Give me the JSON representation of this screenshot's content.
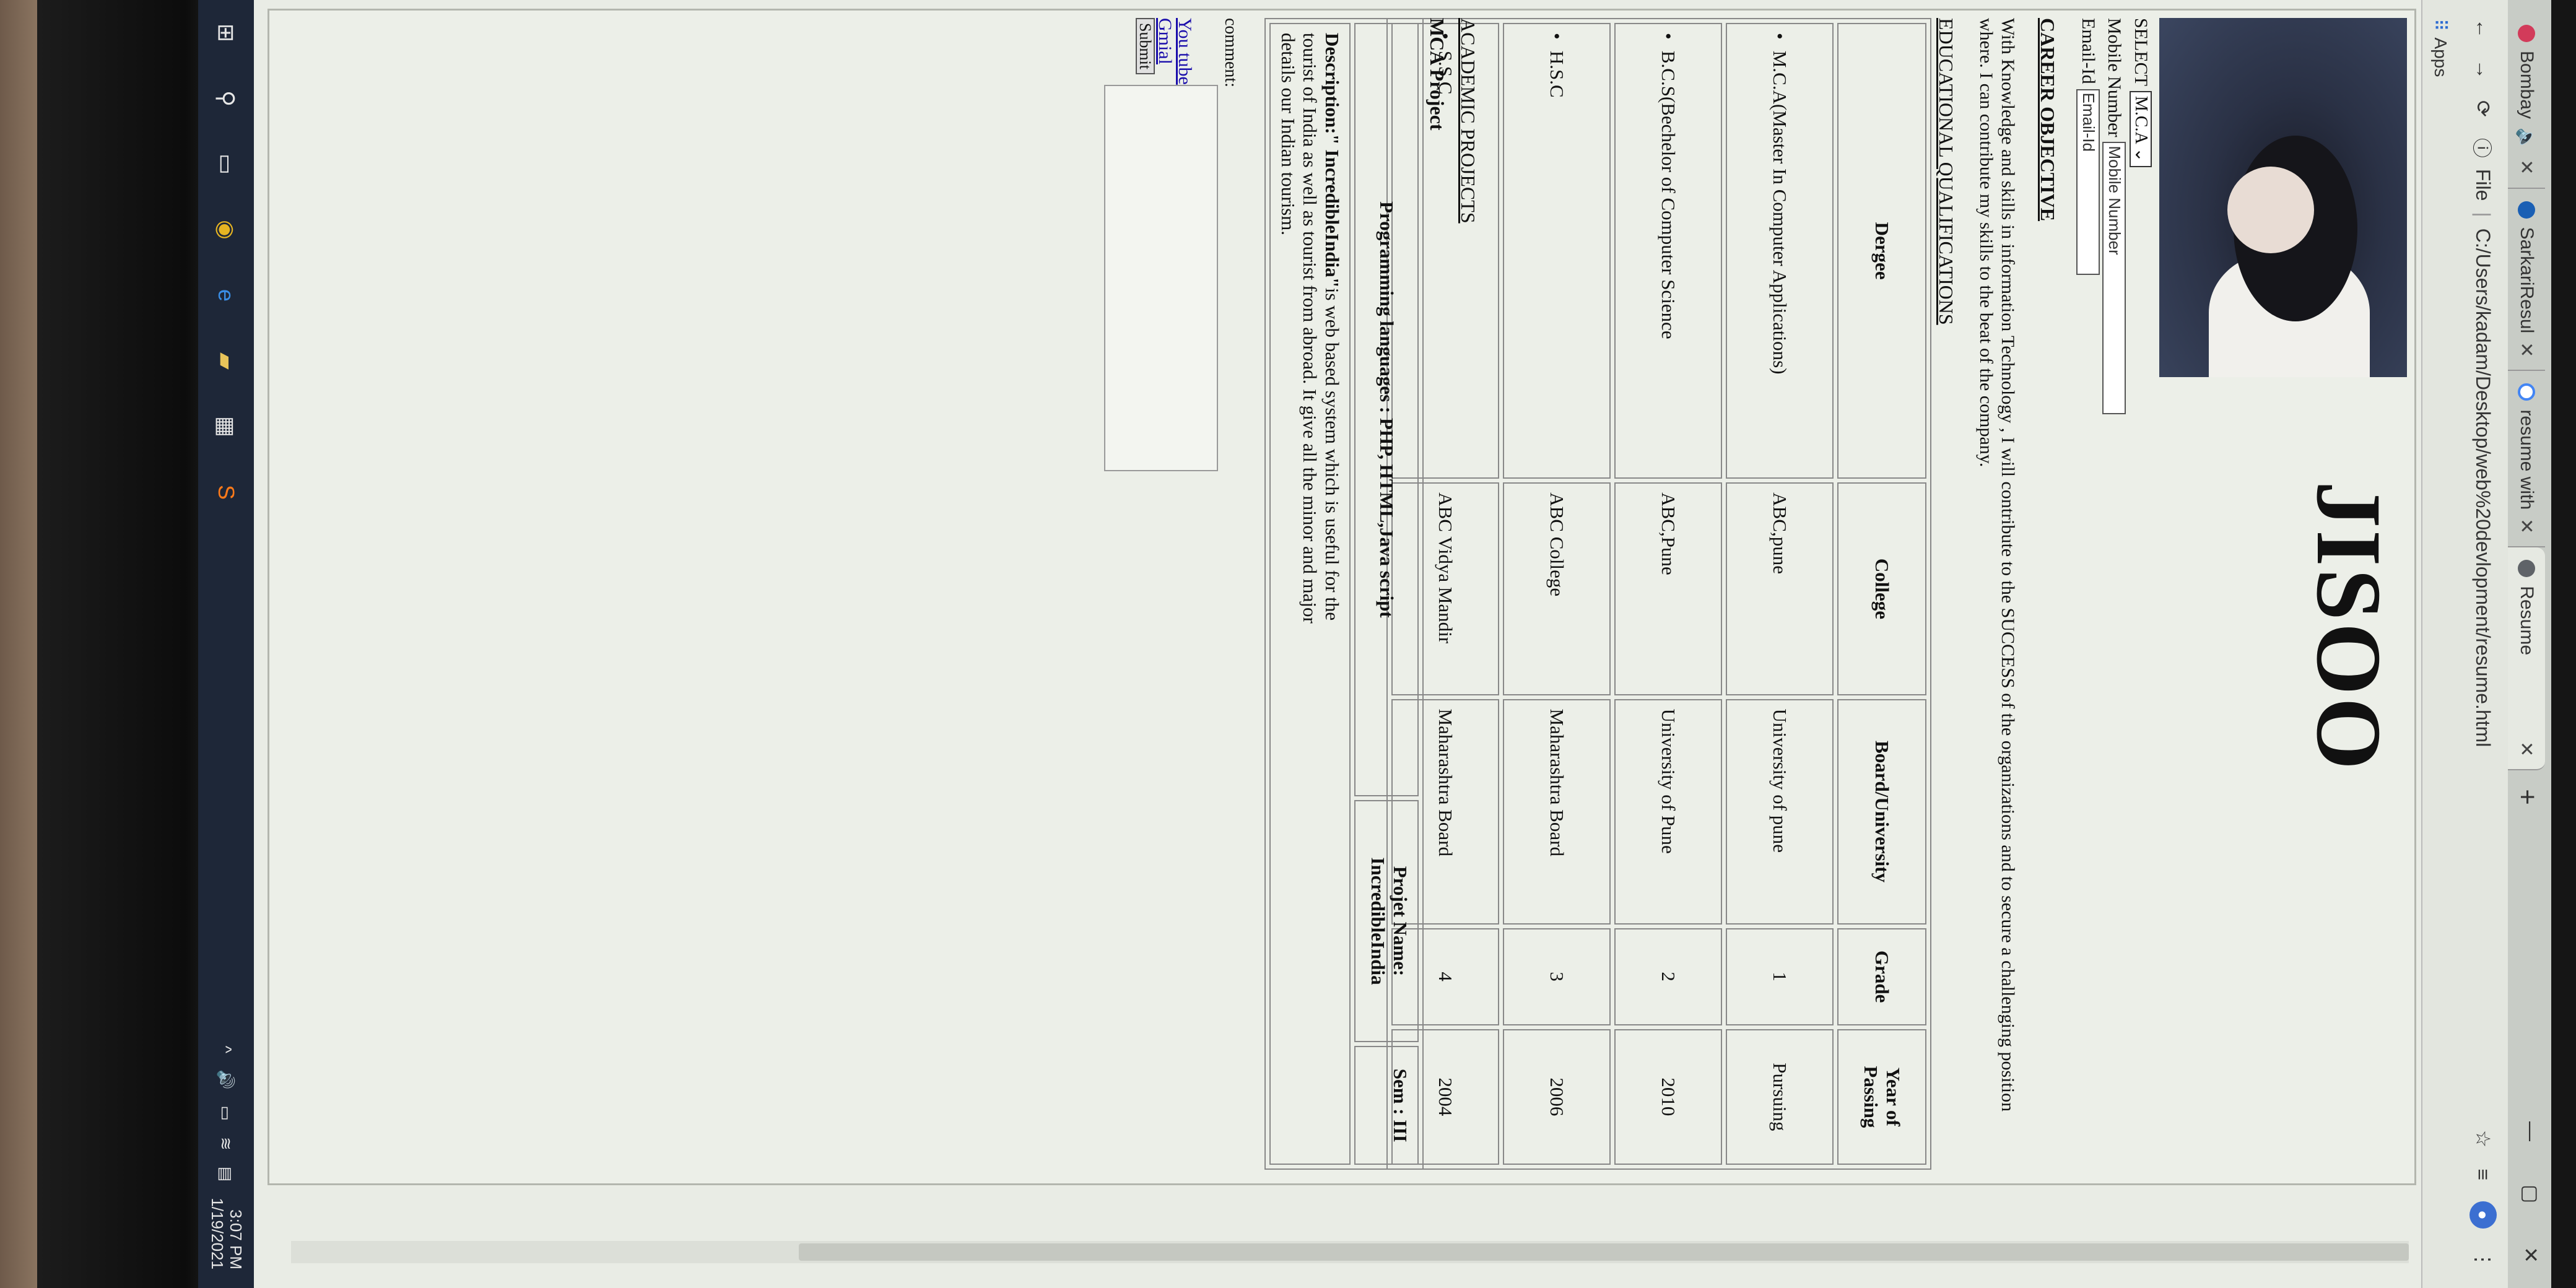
{
  "browser": {
    "tabs": [
      {
        "title": "Bombay",
        "favicon_color": "#d23b5a",
        "icon": "speaker-icon"
      },
      {
        "title": "SarkariResul",
        "favicon_color": "#1a5fb4"
      },
      {
        "title": "resume with",
        "favicon_color": "#4285f4",
        "icon": "google-icon"
      },
      {
        "title": "Resume",
        "favicon_color": "#5f6368",
        "active": true
      }
    ],
    "tab_close": "✕",
    "new_tab": "+",
    "url_prefix": "File",
    "url": "C:/Users/kadam/Desktop/web%20devlopment/resume.html",
    "bookmarks_label": "Apps"
  },
  "resume": {
    "name": "JISOO",
    "select_label": "SELECT",
    "select_value": "M.C.A",
    "mobile_label": "Mobile Number",
    "mobile_placeholder": "Mobile Number",
    "email_label": "Email-Id",
    "email_placeholder": "Email-Id",
    "career_heading": "CAREER OBJECTIVE",
    "career_text": "With Knowledge and skills in information Technology , I will contribute to the SUCCESS of the organizations and to secure a challenging position where. I can contribute my skills to the beat of the company.",
    "edu_heading": "EDUCATIONAL QUALIFICATIONS",
    "edu_headers": [
      "Dergee",
      "College",
      "Board/University",
      "Grade",
      "Year of Passing"
    ],
    "edu_rows": [
      {
        "degree": "M.C.A(Master In Computer Applications)",
        "college": "ABC,pune",
        "board": "University of pune",
        "grade": "1",
        "year": "Pursuing"
      },
      {
        "degree": "B.C.S(Bechelor of Computer Science",
        "college": "ABC,Pune",
        "board": "University of Pune",
        "grade": "2",
        "year": "2010"
      },
      {
        "degree": "H.S.C",
        "college": "ABC College",
        "board": "Maharashtra Board",
        "grade": "3",
        "year": "2006"
      },
      {
        "degree": "S.S.C",
        "college": "ABC Vidya Mandir",
        "board": "Maharashtra Board",
        "grade": "4",
        "year": "2004"
      }
    ],
    "projects_heading": "ACADEMIC PROJECTS",
    "mca_project_heading": "MCA Project",
    "project": {
      "languages": "Programming languages : PHP, HTML,Java script",
      "name": "Projet Name: IncredibleIndia",
      "sem": "Sem : III",
      "description_label": "Description:\" IncredibleIndia\"",
      "description_text": "is web based system which is useful for the tourist of India as well as tourist from abroad. It give all the minor and major details our Indian tourism."
    },
    "comment_label": "comment:",
    "links": [
      "You tube",
      "Gmial"
    ],
    "submit_label": "Submit"
  },
  "taskbar": {
    "time": "3:07 PM",
    "date": "1/19/2021"
  }
}
